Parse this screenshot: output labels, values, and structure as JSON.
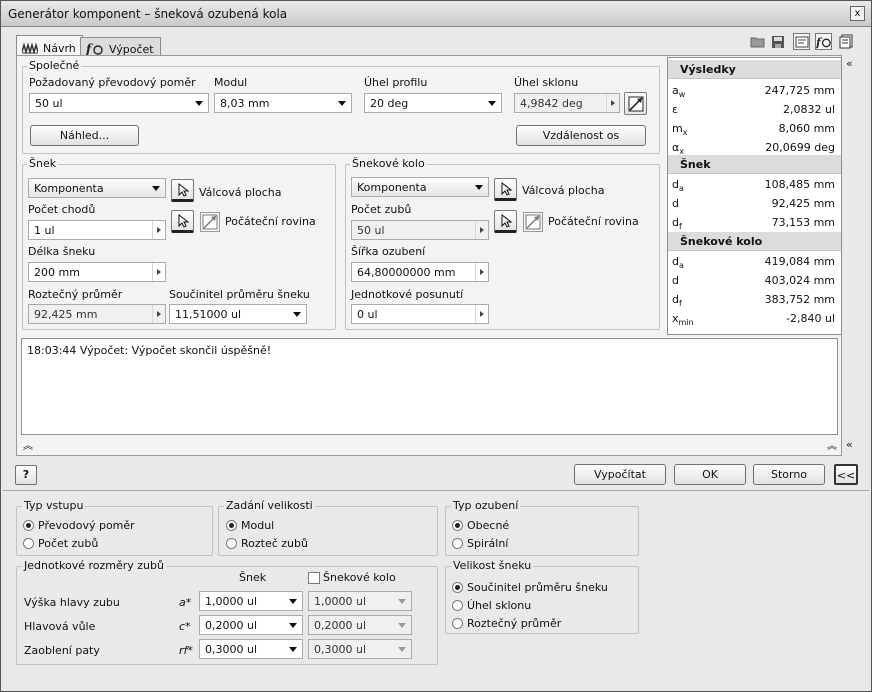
{
  "window": {
    "title": "Generátor komponent – šneková ozubená kola",
    "close": "x"
  },
  "tabs": [
    {
      "label": "Návrh"
    },
    {
      "label": "Výpočet"
    }
  ],
  "common": {
    "group": "Společné",
    "ratio": {
      "label": "Požadovaný převodový poměr",
      "value": "50 ul"
    },
    "module": {
      "label": "Modul",
      "value": "8,03 mm"
    },
    "profile_angle": {
      "label": "Úhel profilu",
      "value": "20 deg"
    },
    "helix_angle": {
      "label": "Úhel sklonu",
      "value": "4,9842 deg"
    },
    "preview_button": "Náhled...",
    "center_distance_button": "Vzdálenost os"
  },
  "worm": {
    "group": "Šnek",
    "type": "Komponenta",
    "cyl_face": "Válcová plocha",
    "start_plane": "Počáteční rovina",
    "threads": {
      "label": "Počet chodů",
      "value": "1 ul"
    },
    "length": {
      "label": "Délka šneku",
      "value": "200 mm"
    },
    "pitch_diameter": {
      "label": "Roztečný průměr",
      "value": "92,425 mm"
    },
    "diameter_factor": {
      "label": "Součinitel průměru šneku",
      "value": "11,51000 ul"
    }
  },
  "wheel": {
    "group": "Šnekové kolo",
    "type": "Komponenta",
    "cyl_face": "Válcová plocha",
    "start_plane": "Počáteční rovina",
    "teeth": {
      "label": "Počet zubů",
      "value": "50 ul"
    },
    "face_width": {
      "label": "Šířka ozubení",
      "value": "64,80000000 mm"
    },
    "unit_shift": {
      "label": "Jednotkové posunutí",
      "value": "0 ul"
    }
  },
  "results": {
    "title": "Výsledky",
    "general": [
      {
        "sym": "a",
        "sub": "w",
        "value": "247,725 mm"
      },
      {
        "sym": "ε",
        "sub": "",
        "value": "2,0832 ul"
      },
      {
        "sym": "m",
        "sub": "x",
        "value": "8,060 mm"
      },
      {
        "sym": "α",
        "sub": "x",
        "value": "20,0699 deg"
      }
    ],
    "worm_title": "Šnek",
    "worm": [
      {
        "sym": "d",
        "sub": "a",
        "value": "108,485 mm"
      },
      {
        "sym": "d",
        "sub": "",
        "value": "92,425 mm"
      },
      {
        "sym": "d",
        "sub": "f",
        "value": "73,153 mm"
      }
    ],
    "wheel_title": "Šnekové kolo",
    "wheel": [
      {
        "sym": "d",
        "sub": "a",
        "value": "419,084 mm"
      },
      {
        "sym": "d",
        "sub": "",
        "value": "403,024 mm"
      },
      {
        "sym": "d",
        "sub": "f",
        "value": "383,752 mm"
      },
      {
        "sym": "x",
        "sub": "min",
        "value": "-2,840 ul"
      }
    ]
  },
  "log": {
    "text": "18:03:44 Výpočet: Výpočet skončil úspěšně!"
  },
  "buttons": {
    "help": "?",
    "calculate": "Vypočítat",
    "ok": "OK",
    "cancel": "Storno",
    "collapse": "<<"
  },
  "input_type": {
    "group": "Typ vstupu",
    "options": [
      "Převodový poměr",
      "Počet zubů"
    ],
    "selected": 0
  },
  "size_input": {
    "group": "Zadání velikosti",
    "options": [
      "Modul",
      "Rozteč zubů"
    ],
    "selected": 0
  },
  "tooth_type": {
    "group": "Typ ozubení",
    "options": [
      "Obecné",
      "Spirální"
    ],
    "selected": 0
  },
  "tooth_dims": {
    "group": "Jednotkové rozměry zubů",
    "col_worm": "Šnek",
    "col_wheel": "Šnekové kolo",
    "rows": [
      {
        "label": "Výška hlavy zubu",
        "sym": "a*",
        "worm": "1,0000 ul",
        "wheel": "1,0000 ul"
      },
      {
        "label": "Hlavová vůle",
        "sym": "c*",
        "worm": "0,2000 ul",
        "wheel": "0,2000 ul"
      },
      {
        "label": "Zaoblení paty",
        "sym": "rf*",
        "worm": "0,3000 ul",
        "wheel": "0,3000 ul"
      }
    ]
  },
  "worm_size": {
    "group": "Velikost šneku",
    "options": [
      "Součinitel průměru šneku",
      "Úhel sklonu",
      "Roztečný průměr"
    ],
    "selected": 0
  }
}
